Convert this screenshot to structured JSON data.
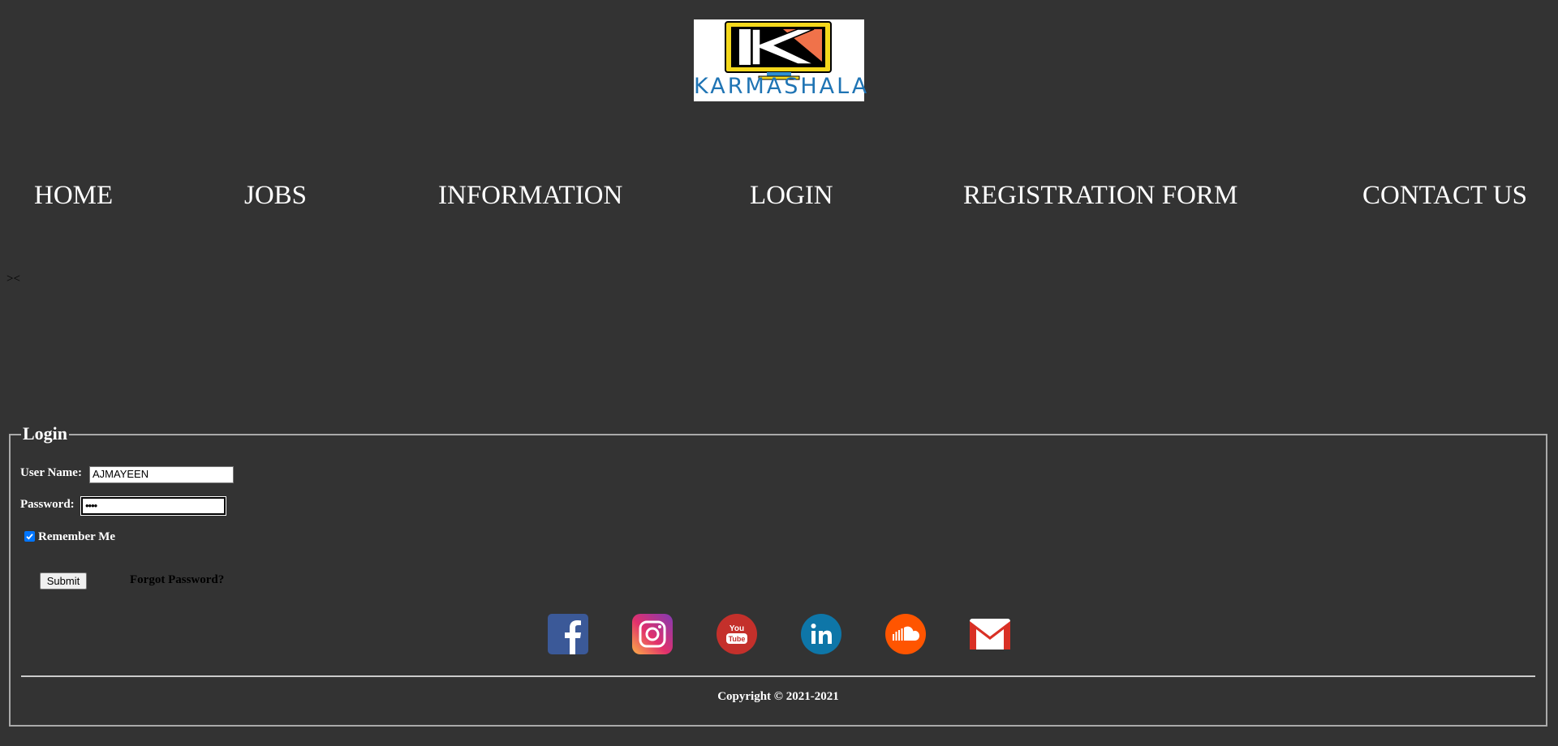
{
  "logo": {
    "wordmark": "KARMASHALA",
    "colors": {
      "frame": "#f4d81c",
      "accent": "#f0724a",
      "screen": "#000000",
      "text": "#1f74b4"
    }
  },
  "nav": {
    "items": [
      {
        "label": "HOME"
      },
      {
        "label": "JOBS"
      },
      {
        "label": "INFORMATION"
      },
      {
        "label": "LOGIN"
      },
      {
        "label": "REGISTRATION FORM"
      },
      {
        "label": "CONTACT US"
      }
    ]
  },
  "stray_text": "><",
  "login": {
    "legend": "Login",
    "username_label": "User Name:",
    "username_value": "AJMAYEEN",
    "password_label": "Password:",
    "password_value": "••••",
    "remember_label": "Remember Me",
    "remember_checked": true,
    "submit_label": "Submit",
    "forgot_label": "Forgot Password?"
  },
  "social": [
    {
      "icon": "facebook-icon",
      "color": "#3b5998"
    },
    {
      "icon": "instagram-icon",
      "color": "#d6249f"
    },
    {
      "icon": "youtube-icon",
      "color": "#c4302b"
    },
    {
      "icon": "linkedin-icon",
      "color": "#0e76a8"
    },
    {
      "icon": "soundcloud-icon",
      "color": "#ff5500"
    },
    {
      "icon": "gmail-icon",
      "color": "#d93025"
    }
  ],
  "footer": {
    "copyright": "Copyright © 2021-2021"
  },
  "colors": {
    "background": "#333333",
    "text": "#ffffff",
    "border": "#aaaaaa"
  }
}
